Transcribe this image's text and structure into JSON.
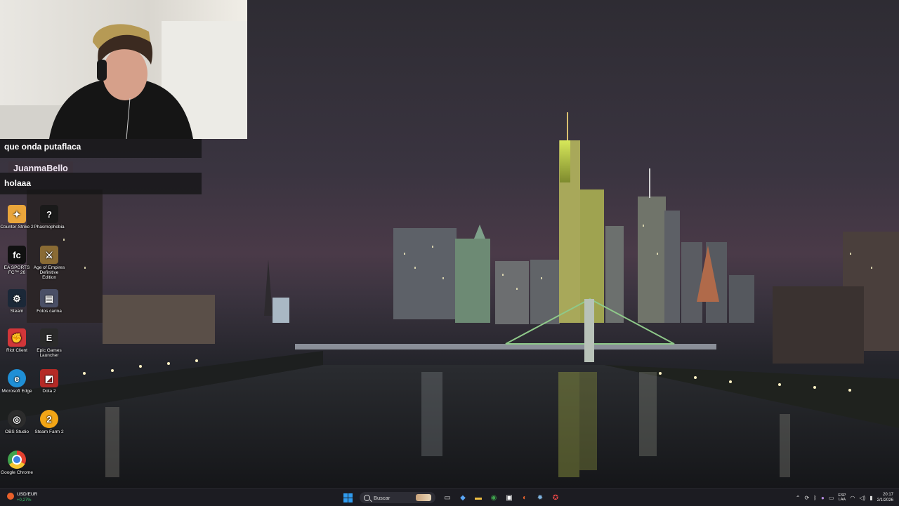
{
  "chat": {
    "message1": "que onda putaflaca",
    "username": "JuanmaBello",
    "message2": "holaaa"
  },
  "desktop_icons": [
    {
      "label": "Counter-Strike 2",
      "icon": "counter-strike-icon",
      "color": "#e9a53b"
    },
    {
      "label": "Phasmophobia",
      "icon": "phasmophobia-icon",
      "color": "#1a1a1a"
    },
    {
      "label": "EA SPORTS FC™ 26",
      "icon": "ea-sports-fc-icon",
      "color": "#111"
    },
    {
      "label": "Age of Empires Definitive Edition",
      "icon": "age-of-empires-icon",
      "color": "#8a6b34"
    },
    {
      "label": "Steam",
      "icon": "steam-icon",
      "color": "#1b2838"
    },
    {
      "label": "Fotos carina",
      "icon": "folder-icon",
      "color": "#4a4f66"
    },
    {
      "label": "Riot Client",
      "icon": "riot-client-icon",
      "color": "#d13639"
    },
    {
      "label": "Epic Games Launcher",
      "icon": "epic-games-icon",
      "color": "#2a2a2a"
    },
    {
      "label": "Microsoft Edge",
      "icon": "edge-icon",
      "color": "#1f8fd6"
    },
    {
      "label": "Dota 2",
      "icon": "dota-icon",
      "color": "#b52a26"
    },
    {
      "label": "OBS Studio",
      "icon": "obs-icon",
      "color": "#2c2c2c"
    },
    {
      "label": "Steam Farm 2",
      "icon": "steam-farm-icon",
      "color": "#f2a516"
    },
    {
      "label": "Google Chrome",
      "icon": "chrome-icon",
      "color": "#e3402f"
    }
  ],
  "taskbar": {
    "weather_line1": "USD/EUR",
    "weather_line2": "+0,27%",
    "search_placeholder": "Buscar",
    "pinned_apps": [
      {
        "name": "task-view-icon",
        "glyph": "▭",
        "color": "#dddddd"
      },
      {
        "name": "copilot-icon",
        "glyph": "◆",
        "color": "#5aa6f5"
      },
      {
        "name": "file-explorer-icon",
        "glyph": "▬",
        "color": "#f0c043"
      },
      {
        "name": "chrome-icon",
        "glyph": "◉",
        "color": "#3fa34d"
      },
      {
        "name": "store-icon",
        "glyph": "▣",
        "color": "#ffffff"
      },
      {
        "name": "brave-icon",
        "glyph": "◐",
        "color": "#e8632c"
      },
      {
        "name": "steam-icon",
        "glyph": "✹",
        "color": "#7fb4e0"
      },
      {
        "name": "riot-client-icon",
        "glyph": "✪",
        "color": "#e24545"
      }
    ],
    "lang_top": "ESP",
    "lang_bottom": "LAA",
    "time": "20:17",
    "date": "2/1/2026"
  }
}
